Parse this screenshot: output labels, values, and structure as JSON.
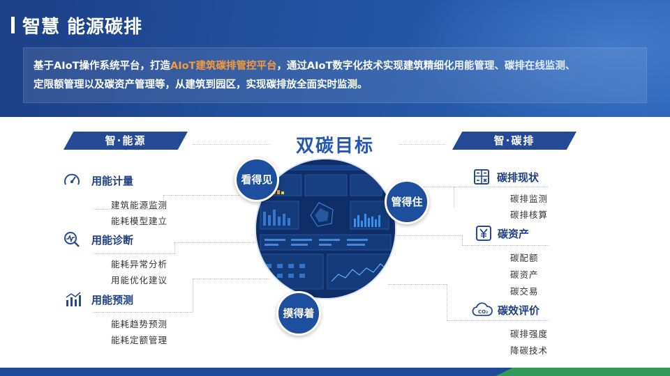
{
  "header": {
    "title": "智慧 能源碳排",
    "intro_part1": "基于AIoT操作系统平台，打造",
    "intro_highlight": "AIoT建筑碳排管控平台",
    "intro_part2": "，通过AIoT数字化技术实现建筑精细化用能管理、碳排在线监测、",
    "intro_line2": "定限额管理以及碳资产管理等，从建筑到园区，实现碳排放全面实时监测。",
    "highlight_color": "#f59a3a"
  },
  "left_banner": "智·能源",
  "right_banner": "智·碳排",
  "center": {
    "title": "双碳目标",
    "bubbles": [
      "看得见",
      "管得住",
      "摸得着"
    ]
  },
  "left": [
    {
      "label": "用能计量",
      "icon": "gauge-icon",
      "items": [
        "建筑能源监测",
        "能耗模型建立"
      ]
    },
    {
      "label": "用能诊断",
      "icon": "diagnosis-icon",
      "items": [
        "能耗异常分析",
        "用能优化建议"
      ]
    },
    {
      "label": "用能预测",
      "icon": "bar-trend-icon",
      "items": [
        "能耗趋势预测",
        "能耗定额管理"
      ]
    }
  ],
  "right": [
    {
      "label": "碳排现状",
      "icon": "calculator-icon",
      "items": [
        "碳排监测",
        "碳排核算"
      ]
    },
    {
      "label": "碳资产",
      "icon": "yen-icon",
      "items": [
        "碳配额",
        "碳资产",
        "碳交易"
      ]
    },
    {
      "label": "碳效评价",
      "icon": "co2-cloud-icon",
      "items": [
        "碳排强度",
        "降碳技术"
      ]
    }
  ],
  "colors": {
    "navy": "#244a96",
    "title_blue": "#2456b4",
    "footer_green": "#2f9a5a"
  }
}
